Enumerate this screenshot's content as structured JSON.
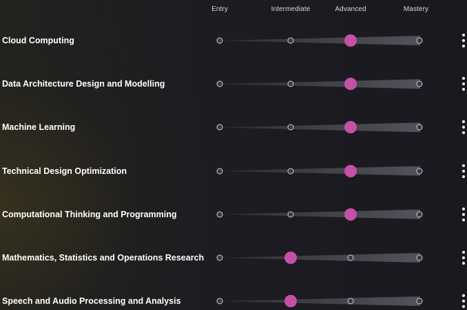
{
  "levels": [
    "Entry",
    "Intermediate",
    "Advanced",
    "Mastery"
  ],
  "skills": [
    {
      "name": "Cloud Computing",
      "level": 2
    },
    {
      "name": "Data Architecture Design and Modelling",
      "level": 2
    },
    {
      "name": "Machine Learning",
      "level": 2
    },
    {
      "name": "Technical Design Optimization",
      "level": 2
    },
    {
      "name": "Computational Thinking and Programming",
      "level": 2
    },
    {
      "name": "Mathematics, Statistics and Operations Research",
      "level": 1
    },
    {
      "name": "Speech and Audio Processing and Analysis",
      "level": 1
    }
  ],
  "colors": {
    "thumb": "#c451a6",
    "node_border": "#cfcfd6",
    "background": "#1b1b22"
  },
  "icons": {
    "row_menu": "more-vertical-icon",
    "level_node": "circle-icon"
  }
}
